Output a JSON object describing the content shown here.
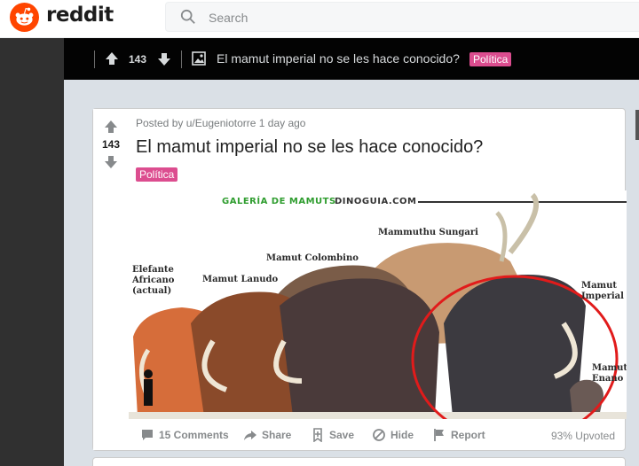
{
  "header": {
    "logo_text": "reddit",
    "search_placeholder": "Search",
    "brand_color": "#ff4500"
  },
  "sticky_bar": {
    "score": "143",
    "title": "El mamut imperial no se les hace conocido?",
    "flair": "Política"
  },
  "post": {
    "score": "143",
    "byline": "Posted by u/Eugeniotorre 1 day ago",
    "title": "El mamut imperial no se les hace conocido?",
    "flair": "Política",
    "flair_color": "#dc4d8f",
    "image": {
      "header_left": "GALERÍA DE MAMUTS",
      "header_right": "DINOGUIA.COM",
      "labels": {
        "elefante": "Elefante\nAfricano\n(actual)",
        "lanudo": "Mamut Lanudo",
        "colombino": "Mamut Colombino",
        "sungari": "Mammuthu Sungari",
        "imperial": "Mamut\nImperial",
        "enano": "Mamut\nEnano"
      }
    },
    "actions": {
      "comments": "15 Comments",
      "share": "Share",
      "save": "Save",
      "hide": "Hide",
      "report": "Report"
    },
    "upvoted": "93% Upvoted"
  }
}
